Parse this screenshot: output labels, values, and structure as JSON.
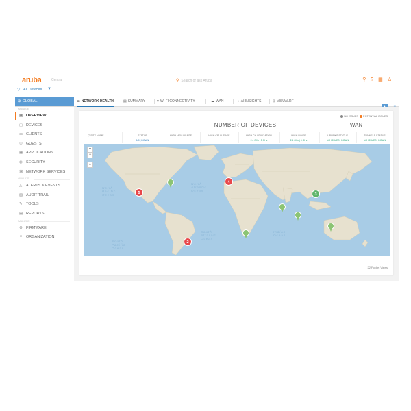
{
  "topbar": {
    "logo": "aruba",
    "logo_sub": "Central",
    "search_placeholder": "Search or ask Aruba",
    "icons": [
      "search-icon",
      "help-icon",
      "grid-icon",
      "user-icon"
    ]
  },
  "scope": {
    "label": "All Devices"
  },
  "tabbar": {
    "global_label": "GLOBAL",
    "tabs": [
      {
        "label": "NETWORK HEALTH",
        "icon": "monitor-icon",
        "active": true
      },
      {
        "label": "SUMMARY",
        "icon": "summary-icon",
        "active": false
      },
      {
        "label": "WI-FI CONNECTIVITY",
        "icon": "wifi-icon",
        "active": false
      },
      {
        "label": "WAN",
        "icon": "cloud-icon",
        "active": false
      },
      {
        "label": "AI INSIGHTS",
        "icon": "bulb-icon",
        "active": false
      },
      {
        "label": "VISUALRF",
        "icon": "floorplan-icon",
        "active": false
      }
    ]
  },
  "sidebar": {
    "sections": [
      {
        "title": "MANAGE",
        "items": [
          {
            "label": "OVERVIEW",
            "icon": "overview-icon",
            "active": true
          },
          {
            "label": "DEVICES",
            "icon": "devices-icon"
          },
          {
            "label": "CLIENTS",
            "icon": "clients-icon"
          },
          {
            "label": "GUESTS",
            "icon": "guests-icon"
          },
          {
            "label": "APPLICATIONS",
            "icon": "applications-icon"
          },
          {
            "label": "SECURITY",
            "icon": "security-icon"
          },
          {
            "label": "NETWORK SERVICES",
            "icon": "network-services-icon"
          }
        ]
      },
      {
        "title": "ANALYZE",
        "items": [
          {
            "label": "ALERTS & EVENTS",
            "icon": "alert-icon"
          },
          {
            "label": "AUDIT TRAIL",
            "icon": "audit-icon"
          },
          {
            "label": "TOOLS",
            "icon": "tools-icon"
          },
          {
            "label": "REPORTS",
            "icon": "reports-icon"
          }
        ]
      },
      {
        "title": "MAINTAIN",
        "items": [
          {
            "label": "FIRMWARE",
            "icon": "firmware-icon"
          },
          {
            "label": "ORGANIZATION",
            "icon": "organization-icon"
          }
        ]
      }
    ]
  },
  "panel": {
    "legend": {
      "no_issues": "NO ISSUES",
      "potential_issues": "POTENTIAL ISSUES",
      "no_issues_color": "#888888",
      "potential_color": "#f47b20"
    },
    "num_devices_title": "NUMBER OF DEVICES",
    "wan_title": "WAN",
    "columns": [
      {
        "head": "SITE NAME",
        "sub": ""
      },
      {
        "head": "STATUS",
        "sub": "1/0 | DOWN"
      },
      {
        "head": "HIGH MEM USAGE",
        "sub": ""
      },
      {
        "head": "HIGH CPU USAGE",
        "sub": ""
      },
      {
        "head": "HIGH CH UTILIZATION",
        "sub": "2.4 GHz | 5 GHz"
      },
      {
        "head": "HIGH NOISE",
        "sub": "2.4 GHz | 5 GHz"
      },
      {
        "head": "UPLINKS STATUS",
        "sub": "NO ISSUES | DOWN"
      },
      {
        "head": "TUNNELS STATUS",
        "sub": "NO ISSUES | DOWN"
      }
    ],
    "map": {
      "markers": [
        {
          "label": "5",
          "status": "potential",
          "color": "#e8474a"
        },
        {
          "label": "",
          "status": "ok",
          "color": "#8cc474"
        },
        {
          "label": "4",
          "status": "potential",
          "color": "#e8474a"
        },
        {
          "label": "2",
          "status": "potential",
          "color": "#e8474a"
        },
        {
          "label": "",
          "status": "ok",
          "color": "#8cc474"
        },
        {
          "label": "",
          "status": "ok",
          "color": "#8cc474"
        },
        {
          "label": "3",
          "status": "ok",
          "color": "#5fb56a"
        },
        {
          "label": "",
          "status": "ok",
          "color": "#8cc474"
        },
        {
          "label": "",
          "status": "ok",
          "color": "#8cc474"
        }
      ]
    },
    "footer_note": "22 Pocket Views"
  }
}
